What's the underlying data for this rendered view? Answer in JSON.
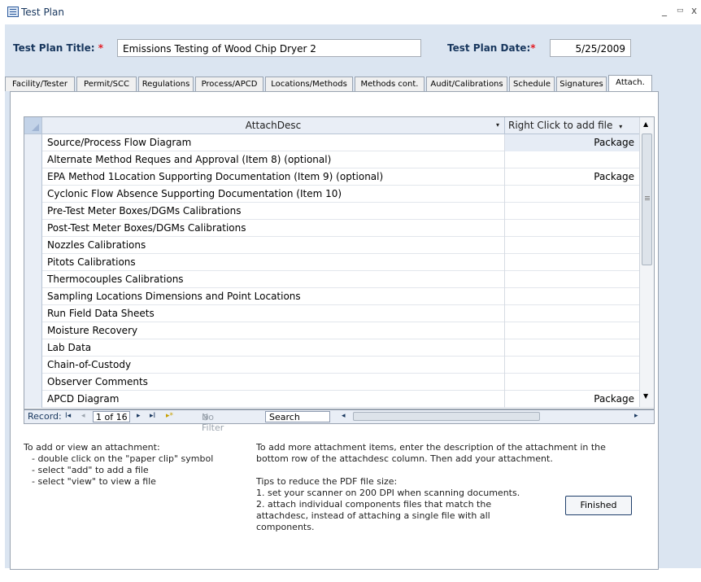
{
  "window": {
    "title": "Test Plan",
    "minimize_glyph": "_",
    "maximize_glyph": "▭",
    "close_glyph": "x"
  },
  "header": {
    "title_label": "Test Plan Title:",
    "title_value": "Emissions Testing of Wood Chip Dryer 2",
    "date_label": "Test Plan Date:",
    "date_value": "5/25/2009",
    "required_mark": "*"
  },
  "tabs": [
    {
      "label": "Facility/Tester"
    },
    {
      "label": "Permit/SCC"
    },
    {
      "label": "Regulations"
    },
    {
      "label": "Process/APCD"
    },
    {
      "label": "Locations/Methods"
    },
    {
      "label": "Methods cont."
    },
    {
      "label": "Audit/Calibrations"
    },
    {
      "label": "Schedule"
    },
    {
      "label": "Signatures"
    },
    {
      "label": "Attach."
    }
  ],
  "active_tab": "Attach.",
  "grid": {
    "col1_header": "AttachDesc",
    "col2_header": "Right Click to add file",
    "rows": [
      {
        "desc": "Source/Process Flow Diagram",
        "file": "Package"
      },
      {
        "desc": "Alternate Method Reques and Approval (Item 8) (optional)",
        "file": ""
      },
      {
        "desc": "EPA Method 1Location Supporting Documentation (Item 9) (optional)",
        "file": "Package"
      },
      {
        "desc": "Cyclonic Flow Absence Supporting Documentation (Item 10)",
        "file": ""
      },
      {
        "desc": "Pre-Test Meter Boxes/DGMs Calibrations",
        "file": ""
      },
      {
        "desc": "Post-Test Meter Boxes/DGMs Calibrations",
        "file": ""
      },
      {
        "desc": "Nozzles Calibrations",
        "file": ""
      },
      {
        "desc": "Pitots Calibrations",
        "file": ""
      },
      {
        "desc": "Thermocouples Calibrations",
        "file": ""
      },
      {
        "desc": "Sampling Locations Dimensions and Point Locations",
        "file": ""
      },
      {
        "desc": "Run Field Data Sheets",
        "file": ""
      },
      {
        "desc": "Moisture Recovery",
        "file": ""
      },
      {
        "desc": "Lab Data",
        "file": ""
      },
      {
        "desc": "Chain-of-Custody",
        "file": ""
      },
      {
        "desc": "Observer Comments",
        "file": ""
      },
      {
        "desc": "APCD Diagram",
        "file": "Package"
      }
    ]
  },
  "navigator": {
    "record_label": "Record:",
    "record_position": "1 of 16",
    "no_filter_label": "No Filter",
    "search_label": "Search",
    "first_glyph": "I◂",
    "prev_glyph": "◂",
    "next_glyph": "▸",
    "last_glyph": "▸I",
    "new_glyph": "▸*",
    "scroll_left_glyph": "◂",
    "scroll_right_glyph": "▸"
  },
  "instructions": {
    "left": [
      "To add or view an attachment:",
      "- double click on the \"paper clip\" symbol",
      "- select \"add\" to add a file",
      "- select \"view\" to view a file"
    ],
    "right_para": [
      "To add more attachment items, enter the description of the attachment in the",
      "bottom row of the attachdesc column. Then add your attachment."
    ],
    "tips": [
      "Tips to reduce the PDF file size:",
      "1. set your scanner on 200 DPI when scanning documents.",
      "2. attach individual components files that match the",
      "attachdesc, instead of attaching a single file with all",
      "components."
    ]
  },
  "finished_button": "Finished",
  "colors": {
    "accent": "#17365d",
    "required": "#e31b23",
    "form_bg": "#dbe5f1"
  }
}
